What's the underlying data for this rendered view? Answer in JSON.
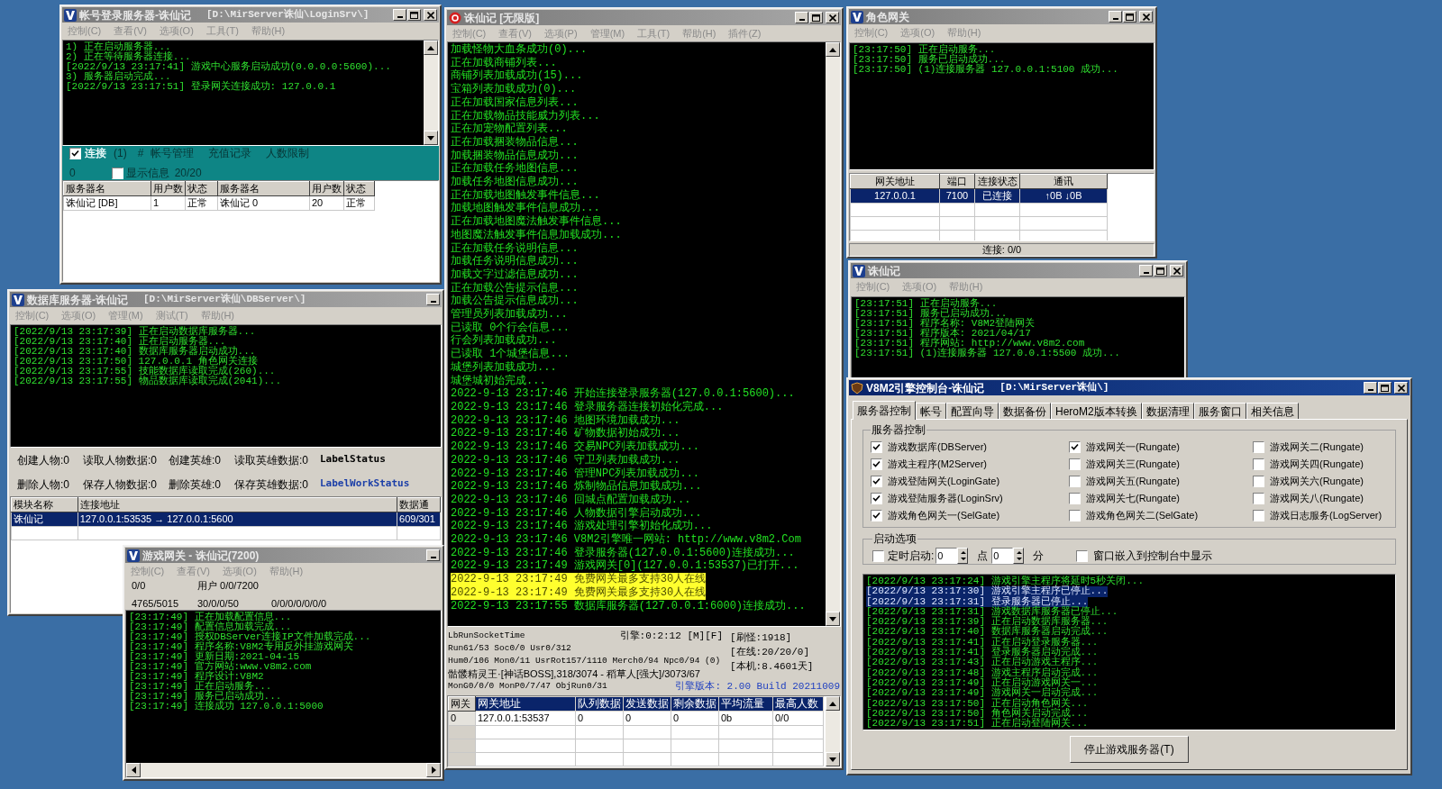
{
  "windows": [
    {
      "kind": "login_server",
      "active": false,
      "title": "帐号登录服务器-诛仙记",
      "path": "[D:\\MirServer诛仙\\LoginSrv\\]",
      "title_buttons": {
        "minimize": true,
        "maximize": true,
        "close": true
      },
      "menu": [
        "控制(C)",
        "查看(V)",
        "选项(O)",
        "工具(T)",
        "帮助(H)"
      ],
      "log": [
        "1) 正在启动服务器...",
        "2) 正在等待服务器连接...",
        "[2022/9/13 23:17:41] 游戏中心服务启动成功(0.0.0.0:5600)...",
        "3) 服务器启动完成...",
        "[2022/9/13 23:17:51] 登录网关连接成功: 127.0.0.1"
      ],
      "panel": {
        "connect": {
          "label": "连接",
          "checked": true
        },
        "count": "(1)",
        "hash": "#",
        "links": [
          "帐号管理",
          "充值记录",
          "人数限制"
        ],
        "value": "0",
        "show_info": {
          "label": "显示信息",
          "checked": false
        },
        "ratio": "20/20"
      },
      "table": {
        "columns": [
          "服务器名",
          "用户数",
          "状态",
          "服务器名",
          "用户数",
          "状态"
        ],
        "rows": [
          {
            "cells": [
              "诛仙记 [DB]",
              "1",
              "正常",
              "诛仙记 0",
              "20",
              "正常"
            ],
            "selected": false
          }
        ]
      }
    },
    {
      "kind": "db_server",
      "active": false,
      "title": "数据库服务器-诛仙记",
      "path": "[D:\\MirServer诛仙\\DBServer\\]",
      "title_buttons": {
        "minimize": true
      },
      "menu": [
        "控制(C)",
        "选项(O)",
        "管理(M)",
        "测试(T)",
        "帮助(H)"
      ],
      "log": [
        "[2022/9/13 23:17:39] 正在启动数据库服务器...",
        "[2022/9/13 23:17:40] 正在启动服务器...",
        "[2022/9/13 23:17:40] 数据库服务器启动成功...",
        "[2022/9/13 23:17:50] 127.0.0.1 角色网关连接",
        "[2022/9/13 23:17:55] 技能数据库读取完成(260)...",
        "[2022/9/13 23:17:55] 物品数据库读取完成(2041)..."
      ],
      "stats": [
        {
          "counters": [
            "创建人物:0",
            "读取人物数据:0",
            "创建英雄:0",
            "读取英雄数据:0"
          ],
          "status": {
            "text": "LabelStatus",
            "color": "#000000"
          }
        },
        {
          "counters": [
            "删除人物:0",
            "保存人物数据:0",
            "删除英雄:0",
            "保存英雄数据:0"
          ],
          "status": {
            "text": "LabelWorkStatus",
            "color": "#1c3fa8"
          }
        }
      ],
      "table": {
        "columns": [
          "模块名称",
          "连接地址",
          "数据通"
        ],
        "rows": [
          {
            "cells": [
              "诛仙记",
              "127.0.0.1:53535 → 127.0.0.1:5600",
              "609/301"
            ],
            "selected": true
          }
        ]
      }
    },
    {
      "kind": "game_gate",
      "active": false,
      "title": "游戏网关 - 诛仙记(7200)",
      "title_buttons": {
        "minimize": true
      },
      "menu": [
        "控制(C)",
        "查看(V)",
        "选项(O)",
        "帮助(H)"
      ],
      "stats": [
        [
          "0/0",
          "用户 0/0/7200"
        ],
        [
          "4765/5015",
          "30/0/0/50",
          "0/0/0/0/0/0/0"
        ]
      ],
      "log": [
        "[23:17:49] 正在加载配置信息...",
        "[23:17:49] 配置信息加载完成...",
        "[23:17:49] 授权DBServer连接IP文件加载完成...",
        "[23:17:49] 程序名称:V8M2专用反外挂游戏网关",
        "[23:17:49] 更新日期:2021-04-15",
        "[23:17:49] 官方网站:www.v8m2.com",
        "[23:17:49] 程序设计:V8M2",
        "[23:17:49] 正在启动服务...",
        "[23:17:49] 服务已启动成功...",
        "[23:17:49] 连接成功 127.0.0.1:5000"
      ]
    },
    {
      "kind": "engine",
      "active": false,
      "title": "诛仙记 [无限版]",
      "title_buttons": {
        "minimize": true,
        "maximize": true,
        "close": true
      },
      "menu": [
        "控制(C)",
        "查看(V)",
        "选项(P)",
        "管理(M)",
        "工具(T)",
        "帮助(H)",
        "插件(Z)"
      ],
      "log": [
        {
          "text": "加载怪物大血条成功(0)...",
          "highlight": false
        },
        {
          "text": "正在加载商铺列表...",
          "highlight": false
        },
        {
          "text": "商铺列表加载成功(15)...",
          "highlight": false
        },
        {
          "text": "宝箱列表加载成功(0)...",
          "highlight": false
        },
        {
          "text": "正在加载国家信息列表...",
          "highlight": false
        },
        {
          "text": "正在加载物品技能威力列表...",
          "highlight": false
        },
        {
          "text": "正在加宠物配置列表...",
          "highlight": false
        },
        {
          "text": "正在加载捆装物品信息...",
          "highlight": false
        },
        {
          "text": "加载捆装物品信息成功...",
          "highlight": false
        },
        {
          "text": "正在加载任务地图信息...",
          "highlight": false
        },
        {
          "text": "加载任务地图信息成功...",
          "highlight": false
        },
        {
          "text": "正在加载地图触发事件信息...",
          "highlight": false
        },
        {
          "text": "加载地图触发事件信息成功...",
          "highlight": false
        },
        {
          "text": "正在加载地图魔法触发事件信息...",
          "highlight": false
        },
        {
          "text": "地图魔法触发事件信息加载成功...",
          "highlight": false
        },
        {
          "text": "正在加载任务说明信息...",
          "highlight": false
        },
        {
          "text": "加载任务说明信息成功...",
          "highlight": false
        },
        {
          "text": "加载文字过滤信息成功...",
          "highlight": false
        },
        {
          "text": "正在加载公告提示信息...",
          "highlight": false
        },
        {
          "text": "加载公告提示信息成功...",
          "highlight": false
        },
        {
          "text": "管理员列表加载成功...",
          "highlight": false
        },
        {
          "text": "已读取 0个行会信息...",
          "highlight": false
        },
        {
          "text": "行会列表加载成功...",
          "highlight": false
        },
        {
          "text": "已读取 1个城堡信息...",
          "highlight": false
        },
        {
          "text": "城堡列表加载成功...",
          "highlight": false
        },
        {
          "text": "城堡城初始完成...",
          "highlight": false
        },
        {
          "text": "2022-9-13 23:17:46 开始连接登录服务器(127.0.0.1:5600)...",
          "highlight": false
        },
        {
          "text": "2022-9-13 23:17:46 登录服务器连接初始化完成...",
          "highlight": false
        },
        {
          "text": "2022-9-13 23:17:46 地图环境加载成功...",
          "highlight": false
        },
        {
          "text": "2022-9-13 23:17:46 矿物数据初始成功...",
          "highlight": false
        },
        {
          "text": "2022-9-13 23:17:46 交易NPC列表加载成功...",
          "highlight": false
        },
        {
          "text": "2022-9-13 23:17:46 守卫列表加载成功...",
          "highlight": false
        },
        {
          "text": "2022-9-13 23:17:46 管理NPC列表加载成功...",
          "highlight": false
        },
        {
          "text": "2022-9-13 23:17:46 炼制物品信息加载成功...",
          "highlight": false
        },
        {
          "text": "2022-9-13 23:17:46 回城点配置加载成功...",
          "highlight": false
        },
        {
          "text": "2022-9-13 23:17:46 人物数据引擎启动成功...",
          "highlight": false
        },
        {
          "text": "2022-9-13 23:17:46 游戏处理引擎初始化成功...",
          "highlight": false
        },
        {
          "text": "2022-9-13 23:17:46 V8M2引擎唯一网站: http://www.v8m2.Com",
          "highlight": false
        },
        {
          "text": "2022-9-13 23:17:46 登录服务器(127.0.0.1:5600)连接成功...",
          "highlight": false
        },
        {
          "text": "2022-9-13 23:17:49 游戏网关[0](127.0.0.1:53537)已打开...",
          "highlight": false
        },
        {
          "text": "2022-9-13 23:17:49 免费网关最多支持30人在线",
          "highlight": true
        },
        {
          "text": "2022-9-13 23:17:49 免费网关最多支持30人在线",
          "highlight": true
        },
        {
          "text": "2022-9-13 23:17:55 数据库服务器(127.0.0.1:6000)连接成功...",
          "highlight": false
        }
      ],
      "status": {
        "lines": [
          "LbRunSocketTime",
          "Run61/53 Soc0/0 Usr0/312",
          "Hum0/106 Mon0/11 UsrRot157/1110 Merch0/94 Npc0/94 (0)",
          "骷髅精灵王·[神话BOSS],318/3074 - 稻草人[强大]/3073/67",
          "MonG0/0/0 MonP0/7/47 ObjRun0/31"
        ],
        "engine": "引擎:0:2:12 [M][F]",
        "counters": [
          "[刷怪:1918]",
          "[在线:20/20/0]",
          "[本机:8.4601天]"
        ],
        "version": "引擎版本: 2.00 Build 20211009"
      },
      "table": {
        "columns": [
          "网关",
          "网关地址",
          "队列数据",
          "发送数据",
          "剩余数据",
          "平均流量",
          "最高人数"
        ],
        "rows": [
          {
            "cells": [
              "0",
              "127.0.0.1:53537",
              "0",
              "0",
              "0",
              "0b",
              "0/0"
            ],
            "selected": false
          }
        ]
      }
    },
    {
      "kind": "sel_gate",
      "active": false,
      "title": "角色网关",
      "title_buttons": {
        "minimize": true,
        "maximize": true,
        "close": true
      },
      "menu": [
        "控制(C)",
        "选项(O)",
        "帮助(H)"
      ],
      "log": [
        "[23:17:50] 正在启动服务...",
        "[23:17:50] 服务已启动成功...",
        "[23:17:50] (1)连接服务器 127.0.0.1:5100 成功..."
      ],
      "table": {
        "columns": [
          "网关地址",
          "端口",
          "连接状态",
          "通讯"
        ],
        "rows": [
          {
            "cells": [
              "127.0.0.1",
              "7100",
              "已连接",
              "↑0B ↓0B"
            ],
            "selected": true
          }
        ]
      },
      "status": "连接: 0/0"
    },
    {
      "kind": "login_gate",
      "active": false,
      "title": "诛仙记",
      "title_buttons": {
        "minimize": true,
        "maximize": true,
        "close": true
      },
      "menu": [
        "控制(C)",
        "选项(O)",
        "帮助(H)"
      ],
      "log": [
        "[23:17:51] 正在启动服务...",
        "[23:17:51] 服务已启动成功...",
        "[23:17:51] 程序名称: V8M2登陆网关",
        "[23:17:51] 程序版本: 2021/04/17",
        "[23:17:51] 程序网站: http://www.v8m2.com",
        "[23:17:51] (1)连接服务器 127.0.0.1:5500 成功..."
      ]
    },
    {
      "kind": "console",
      "active": true,
      "title": "V8M2引擎控制台-诛仙记",
      "path": "[D:\\MirServer诛仙\\]",
      "title_buttons": {
        "minimize": true,
        "maximize": true,
        "close": true
      },
      "tabs": [
        {
          "label": "服务器控制",
          "selected": true
        },
        {
          "label": "帐号",
          "selected": false
        },
        {
          "label": "配置向导",
          "selected": false
        },
        {
          "label": "数据备份",
          "selected": false
        },
        {
          "label": "HeroM2版本转换",
          "selected": false
        },
        {
          "label": "数据清理",
          "selected": false
        },
        {
          "label": "服务窗口",
          "selected": false
        },
        {
          "label": "相关信息",
          "selected": false
        }
      ],
      "server_group": {
        "title": "服务器控制",
        "items": [
          {
            "label": "游戏数据库(DBServer)",
            "checked": true
          },
          {
            "label": "游戏网关一(Rungate)",
            "checked": true
          },
          {
            "label": "游戏网关二(Rungate)",
            "checked": false
          },
          {
            "label": "游戏主程序(M2Server)",
            "checked": true
          },
          {
            "label": "游戏网关三(Rungate)",
            "checked": false
          },
          {
            "label": "游戏网关四(Rungate)",
            "checked": false
          },
          {
            "label": "游戏登陆网关(LoginGate)",
            "checked": true
          },
          {
            "label": "游戏网关五(Rungate)",
            "checked": false
          },
          {
            "label": "游戏网关六(Rungate)",
            "checked": false
          },
          {
            "label": "游戏登陆服务器(LoginSrv)",
            "checked": true
          },
          {
            "label": "游戏网关七(Rungate)",
            "checked": false
          },
          {
            "label": "游戏网关八(Rungate)",
            "checked": false
          },
          {
            "label": "游戏角色网关一(SelGate)",
            "checked": true
          },
          {
            "label": "游戏角色网关二(SelGate)",
            "checked": false
          },
          {
            "label": "游戏日志服务(LogServer)",
            "checked": false
          }
        ]
      },
      "start_group": {
        "title": "启动选项",
        "timer": {
          "label": "定时启动:",
          "checked": false
        },
        "hour": "0",
        "hour_unit": "点",
        "minute": "0",
        "minute_unit": "分",
        "embed": {
          "label": "窗口嵌入到控制台中显示",
          "checked": false
        }
      },
      "log": [
        {
          "text": "[2022/9/13 23:17:24] 游戏引擎主程序将延时5秒关闭...",
          "selected": false
        },
        {
          "text": "[2022/9/13 23:17:30] 游戏引擎主程序已停止...",
          "selected": true
        },
        {
          "text": "[2022/9/13 23:17:31] 登录服务器已停止...",
          "selected": true
        },
        {
          "text": "[2022/9/13 23:17:31] 游戏数据库服务器已停止...",
          "selected": false
        },
        {
          "text": "[2022/9/13 23:17:39] 正在启动数据库服务器...",
          "selected": false
        },
        {
          "text": "[2022/9/13 23:17:40] 数据库服务器启动完成...",
          "selected": false
        },
        {
          "text": "[2022/9/13 23:17:41] 正在启动登录服务器...",
          "selected": false
        },
        {
          "text": "[2022/9/13 23:17:41] 登录服务器启动完成...",
          "selected": false
        },
        {
          "text": "[2022/9/13 23:17:43] 正在启动游戏主程序...",
          "selected": false
        },
        {
          "text": "[2022/9/13 23:17:48] 游戏主程序启动完成...",
          "selected": false
        },
        {
          "text": "[2022/9/13 23:17:49] 正在启动游戏网关一...",
          "selected": false
        },
        {
          "text": "[2022/9/13 23:17:49] 游戏网关一启动完成...",
          "selected": false
        },
        {
          "text": "[2022/9/13 23:17:50] 正在启动角色网关...",
          "selected": false
        },
        {
          "text": "[2022/9/13 23:17:50] 角色网关启动完成...",
          "selected": false
        },
        {
          "text": "[2022/9/13 23:17:51] 正在启动登陆网关...",
          "selected": false
        }
      ],
      "button": "停止游戏服务器(T)"
    }
  ]
}
